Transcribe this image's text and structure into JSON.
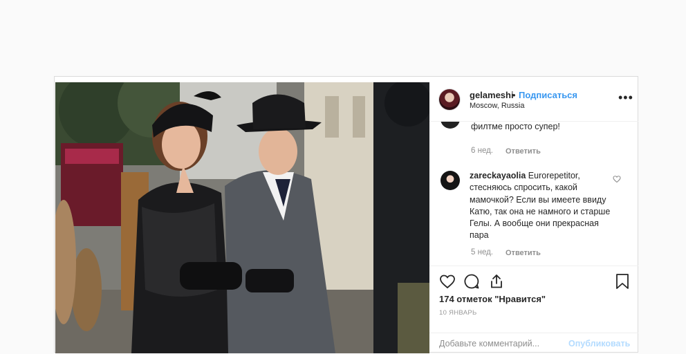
{
  "post": {
    "username": "gelameshi",
    "separator": "•",
    "follow_label": "Подписаться",
    "location": "Moscow, Russia",
    "more_label": "•••"
  },
  "comments": [
    {
      "text": "филтме просто супер!",
      "time": "6 нед.",
      "reply_label": "Ответить"
    },
    {
      "username": "zareckayaolia",
      "text": "Eurorepetitor, стесняюсь спросить, какой мамочкой? Если вы имеете ввиду Катю, так она не намного и старше Гелы. А вообще они прекрасная пара",
      "time": "5 нед.",
      "reply_label": "Ответить"
    }
  ],
  "actions": {
    "likes": "174 отметок \"Нравится\"",
    "date": "10 ЯНВАРЬ"
  },
  "add_comment": {
    "placeholder": "Добавьте комментарий...",
    "publish_label": "Опубликовать"
  },
  "colors": {
    "link": "#3897f0",
    "publish_disabled": "#b3dbff",
    "muted": "#8e8e8e"
  },
  "icons": [
    "heart-icon",
    "comment-icon",
    "share-icon",
    "bookmark-icon",
    "heart-small-icon",
    "more-icon"
  ]
}
